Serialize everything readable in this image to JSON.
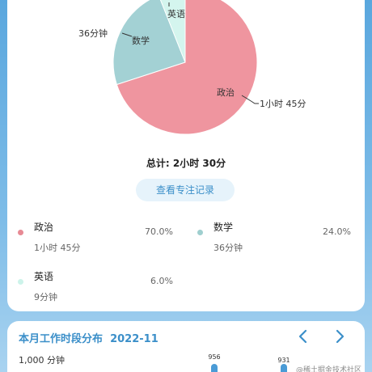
{
  "pie": {
    "slices": [
      {
        "name": "政治",
        "time": "1小时 45分",
        "value": 70.0,
        "color": "#ef959f"
      },
      {
        "name": "数学",
        "time": "36分钟",
        "value": 24.0,
        "color": "#a3d1d4"
      },
      {
        "name": "英语",
        "time": "9分钟",
        "value": 6.0,
        "color": "#d4f5ee"
      }
    ]
  },
  "total": "总计: 2小时 30分",
  "record_button": "查看专注记录",
  "legend": [
    {
      "name": "政治",
      "time": "1小时 45分",
      "pct": "70.0%",
      "color": "#e78a94"
    },
    {
      "name": "数学",
      "time": "36分钟",
      "pct": "24.0%",
      "color": "#9fcfcf"
    },
    {
      "name": "英语",
      "time": "9分钟",
      "pct": "6.0%",
      "color": "#cdf3ea"
    }
  ],
  "month_chart": {
    "title": "本月工作时段分布",
    "month": "2022-11",
    "y_label": "1,000 分钟",
    "bars": [
      {
        "label": "956",
        "value": 956
      },
      {
        "label": "931",
        "value": 931
      }
    ]
  },
  "icons": {
    "prev": "chevron-left-icon",
    "next": "chevron-right-icon"
  },
  "watermark": "@稀土掘金技术社区"
}
